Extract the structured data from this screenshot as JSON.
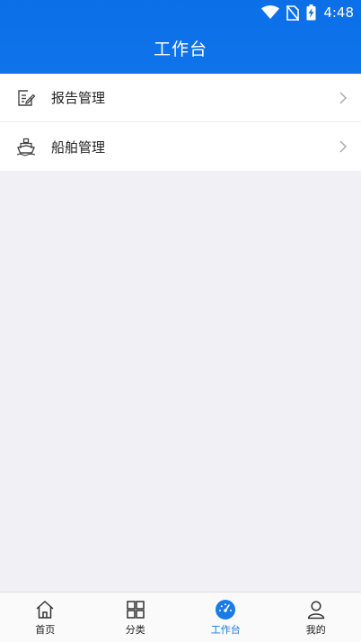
{
  "status_bar": {
    "time": "4:48"
  },
  "header": {
    "title": "工作台"
  },
  "menu": {
    "items": [
      {
        "label": "报告管理",
        "icon": "edit-document-icon"
      },
      {
        "label": "船舶管理",
        "icon": "ship-icon"
      }
    ]
  },
  "tabbar": {
    "items": [
      {
        "label": "首页",
        "icon": "home-icon"
      },
      {
        "label": "分类",
        "icon": "grid-icon"
      },
      {
        "label": "工作台",
        "icon": "dashboard-icon",
        "active": true
      },
      {
        "label": "我的",
        "icon": "user-icon"
      }
    ]
  },
  "colors": {
    "primary": "#0f74ea",
    "active_tab": "#1a7ae6"
  }
}
